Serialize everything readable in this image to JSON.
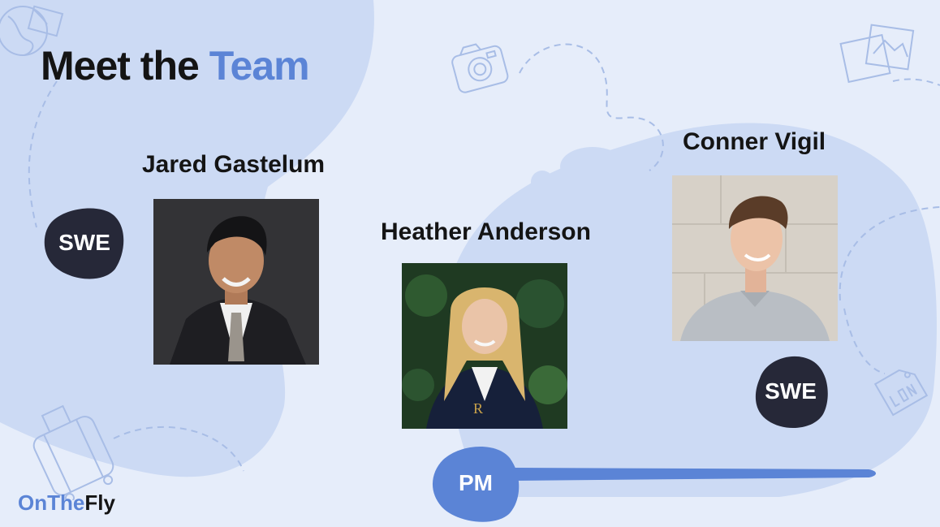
{
  "slide": {
    "title_main": "Meet the ",
    "title_accent": "Team"
  },
  "members": [
    {
      "name": "Jared Gastelum",
      "role": "SWE"
    },
    {
      "name": "Heather Anderson",
      "role": "PM"
    },
    {
      "name": "Conner Vigil",
      "role": "SWE"
    }
  ],
  "logo": {
    "part1": "OnThe",
    "part2": "Fly"
  },
  "colors": {
    "background": "#e6edfa",
    "blob_light": "#ccdaf4",
    "accent": "#5b84d6",
    "badge_dark": "#262838",
    "text": "#141414"
  },
  "icons": [
    "globe-icon",
    "camera-icon",
    "photos-icon",
    "luggage-icon",
    "luggage-tag-icon"
  ]
}
